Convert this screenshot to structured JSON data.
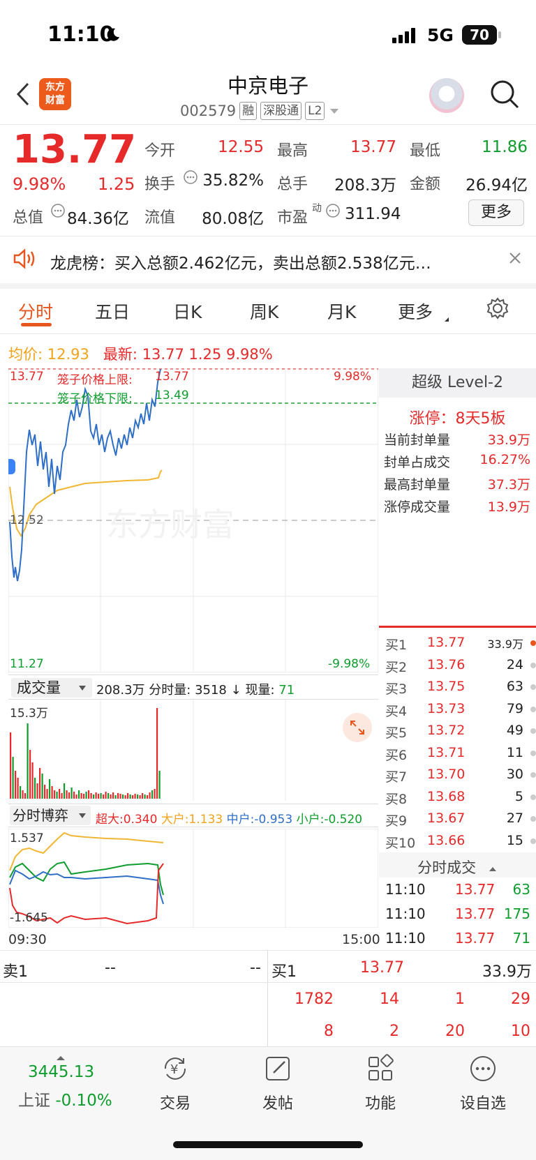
{
  "status_bar": {
    "time": "11:10",
    "network": "5G",
    "battery": "70"
  },
  "header": {
    "logo_line1": "东方",
    "logo_line2": "财富",
    "stock_name": "中京电子",
    "stock_code": "002579",
    "tags": [
      "融",
      "深股通",
      "L2"
    ]
  },
  "quote": {
    "price": "13.77",
    "change_pct": "9.98%",
    "change": "1.25",
    "open_label": "今开",
    "open": "12.55",
    "high_label": "最高",
    "high": "13.77",
    "low_label": "最低",
    "low": "11.86",
    "turnover_label": "换手",
    "turnover": "35.82%",
    "volume_label": "总手",
    "volume": "208.3万",
    "amount_label": "金额",
    "amount": "26.94亿",
    "mktcap_label": "总值",
    "mktcap": "84.36亿",
    "float_label": "流值",
    "float": "80.08亿",
    "pe_label": "市盈",
    "pe_sup": "动",
    "pe": "311.94",
    "more": "更多"
  },
  "ticker": {
    "text": "龙虎榜：买入总额2.462亿元，卖出总额2.538亿元…"
  },
  "tabs": [
    "分时",
    "五日",
    "日K",
    "周K",
    "月K",
    "更多"
  ],
  "chart_header": {
    "avg_label": "均价:",
    "avg": "12.93",
    "latest_label": "最新:",
    "latest": "13.77",
    "chg": "1.25",
    "pct": "9.98%"
  },
  "main_chart": {
    "top_price": "13.77",
    "top_pct": "9.98%",
    "upper_limit_label": "笼子价格上限:",
    "upper_limit": "13.77",
    "lower_limit_label": "笼子价格下限:",
    "lower_limit": "13.49",
    "mid_price": "12.52",
    "bottom_price": "11.27",
    "bottom_pct": "-9.98%",
    "watermark": "东方财富"
  },
  "level2": {
    "title": "超级 Level-2",
    "limit_up": "涨停：8天5板",
    "rows": [
      {
        "label": "当前封单量",
        "value": "33.9万"
      },
      {
        "label": "封单占成交",
        "value": "16.27%"
      },
      {
        "label": "最高封单量",
        "value": "37.3万"
      },
      {
        "label": "涨停成交量",
        "value": "13.9万"
      }
    ]
  },
  "order_book": [
    {
      "label": "买1",
      "price": "13.77",
      "qty": "33.9万"
    },
    {
      "label": "买2",
      "price": "13.76",
      "qty": "24"
    },
    {
      "label": "买3",
      "price": "13.75",
      "qty": "63"
    },
    {
      "label": "买4",
      "price": "13.73",
      "qty": "79"
    },
    {
      "label": "买5",
      "price": "13.72",
      "qty": "49"
    },
    {
      "label": "买6",
      "price": "13.71",
      "qty": "11"
    },
    {
      "label": "买7",
      "price": "13.70",
      "qty": "30"
    },
    {
      "label": "买8",
      "price": "13.68",
      "qty": "5"
    },
    {
      "label": "买9",
      "price": "13.67",
      "qty": "27"
    },
    {
      "label": "买10",
      "price": "13.66",
      "qty": "15"
    }
  ],
  "volume_bar": {
    "dropdown": "成交量",
    "total": "208.3万",
    "minute_label": "分时量:",
    "minute": "3518",
    "now_label": "现量:",
    "now": "71",
    "max": "15.3万"
  },
  "gamble": {
    "dropdown": "分时博弈",
    "super_label": "超大:",
    "super": "0.340",
    "big_label": "大户:",
    "big": "1.133",
    "mid_label": "中户:",
    "mid": "-0.953",
    "small_label": "小户:",
    "small": "-0.520",
    "max": "1.537",
    "min": "-1.645",
    "start": "09:30",
    "end": "15:00"
  },
  "ticks": {
    "title": "分时成交",
    "rows": [
      {
        "time": "11:10",
        "price": "13.77",
        "qty": "63"
      },
      {
        "time": "11:10",
        "price": "13.77",
        "qty": "175"
      },
      {
        "time": "11:10",
        "price": "13.77",
        "qty": "71"
      }
    ]
  },
  "bottom_book": {
    "sell1_label": "卖1",
    "sell1_price": "--",
    "sell1_qty": "--",
    "buy1_label": "买1",
    "buy1_price": "13.77",
    "buy1_qty": "33.9万",
    "queue_row1": [
      "1782",
      "14",
      "1",
      "29"
    ],
    "queue_row2": [
      "8",
      "2",
      "20",
      "10"
    ]
  },
  "footer": {
    "index_value": "3445.13",
    "index_name": "上证",
    "index_pct": "-0.10%",
    "nav": [
      "交易",
      "发帖",
      "功能",
      "设自选"
    ]
  },
  "colors": {
    "up": "#e62a2a",
    "down": "#0f9d2e",
    "accent": "#e8561f",
    "avg_line": "#f2b632",
    "price_line": "#2f6fc7"
  }
}
